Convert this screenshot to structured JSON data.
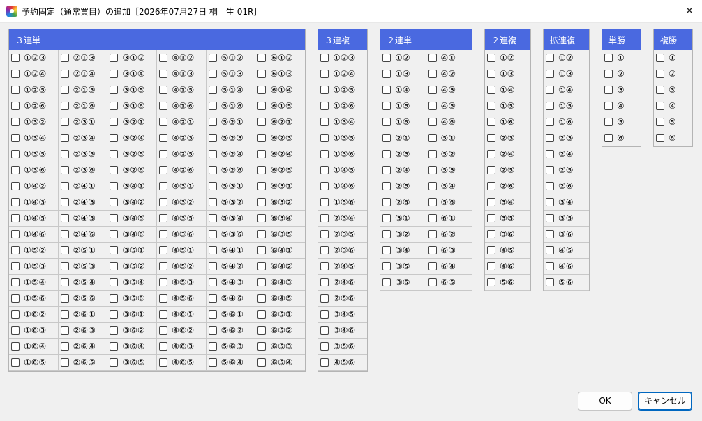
{
  "window": {
    "title": "予約固定（通常買目）の追加［2026年07月27日 桐　生 01R］",
    "close_icon": "✕"
  },
  "groups": [
    {
      "id": "sanrentan",
      "label": "３連単",
      "cols": 6,
      "items": [
        "①②③",
        "②①③",
        "③①②",
        "④①②",
        "⑤①②",
        "⑥①②",
        "①②④",
        "②①④",
        "③①④",
        "④①③",
        "⑤①③",
        "⑥①③",
        "①②⑤",
        "②①⑤",
        "③①⑤",
        "④①⑤",
        "⑤①④",
        "⑥①④",
        "①②⑥",
        "②①⑥",
        "③①⑥",
        "④①⑥",
        "⑤①⑥",
        "⑥①⑤",
        "①③②",
        "②③①",
        "③②①",
        "④②①",
        "⑤②①",
        "⑥②①",
        "①③④",
        "②③④",
        "③②④",
        "④②③",
        "⑤②③",
        "⑥②③",
        "①③⑤",
        "②③⑤",
        "③②⑤",
        "④②⑤",
        "⑤②④",
        "⑥②④",
        "①③⑥",
        "②③⑥",
        "③②⑥",
        "④②⑥",
        "⑤②⑥",
        "⑥②⑤",
        "①④②",
        "②④①",
        "③④①",
        "④③①",
        "⑤③①",
        "⑥③①",
        "①④③",
        "②④③",
        "③④②",
        "④③②",
        "⑤③②",
        "⑥③②",
        "①④⑤",
        "②④⑤",
        "③④⑤",
        "④③⑤",
        "⑤③④",
        "⑥③④",
        "①④⑥",
        "②④⑥",
        "③④⑥",
        "④③⑥",
        "⑤③⑥",
        "⑥③⑤",
        "①⑤②",
        "②⑤①",
        "③⑤①",
        "④⑤①",
        "⑤④①",
        "⑥④①",
        "①⑤③",
        "②⑤③",
        "③⑤②",
        "④⑤②",
        "⑤④②",
        "⑥④②",
        "①⑤④",
        "②⑤④",
        "③⑤④",
        "④⑤③",
        "⑤④③",
        "⑥④③",
        "①⑤⑥",
        "②⑤⑥",
        "③⑤⑥",
        "④⑤⑥",
        "⑤④⑥",
        "⑥④⑤",
        "①⑥②",
        "②⑥①",
        "③⑥①",
        "④⑥①",
        "⑤⑥①",
        "⑥⑤①",
        "①⑥③",
        "②⑥③",
        "③⑥②",
        "④⑥②",
        "⑤⑥②",
        "⑥⑤②",
        "①⑥④",
        "②⑥④",
        "③⑥④",
        "④⑥③",
        "⑤⑥③",
        "⑥⑤③",
        "①⑥⑤",
        "②⑥⑤",
        "③⑥⑤",
        "④⑥⑤",
        "⑤⑥④",
        "⑥⑤④"
      ]
    },
    {
      "id": "sanrenpuku",
      "label": "３連複",
      "cols": 1,
      "items": [
        "①②③",
        "①②④",
        "①②⑤",
        "①②⑥",
        "①③④",
        "①③⑤",
        "①③⑥",
        "①④⑤",
        "①④⑥",
        "①⑤⑥",
        "②③④",
        "②③⑤",
        "②③⑥",
        "②④⑤",
        "②④⑥",
        "②⑤⑥",
        "③④⑤",
        "③④⑥",
        "③⑤⑥",
        "④⑤⑥"
      ]
    },
    {
      "id": "nirentan",
      "label": "２連単",
      "cols": 2,
      "items": [
        "①②",
        "④①",
        "①③",
        "④②",
        "①④",
        "④③",
        "①⑤",
        "④⑤",
        "①⑥",
        "④⑥",
        "②①",
        "⑤①",
        "②③",
        "⑤②",
        "②④",
        "⑤③",
        "②⑤",
        "⑤④",
        "②⑥",
        "⑤⑥",
        "③①",
        "⑥①",
        "③②",
        "⑥②",
        "③④",
        "⑥③",
        "③⑤",
        "⑥④",
        "③⑥",
        "⑥⑤"
      ]
    },
    {
      "id": "nirenpuku",
      "label": "２連複",
      "cols": 1,
      "items": [
        "①②",
        "①③",
        "①④",
        "①⑤",
        "①⑥",
        "②③",
        "②④",
        "②⑤",
        "②⑥",
        "③④",
        "③⑤",
        "③⑥",
        "④⑤",
        "④⑥",
        "⑤⑥"
      ]
    },
    {
      "id": "kakurenpuku",
      "label": "拡連複",
      "cols": 1,
      "items": [
        "①②",
        "①③",
        "①④",
        "①⑤",
        "①⑥",
        "②③",
        "②④",
        "②⑤",
        "②⑥",
        "③④",
        "③⑤",
        "③⑥",
        "④⑤",
        "④⑥",
        "⑤⑥"
      ]
    },
    {
      "id": "tansho",
      "label": "単勝",
      "cols": 1,
      "items": [
        "①",
        "②",
        "③",
        "④",
        "⑤",
        "⑥"
      ]
    },
    {
      "id": "fukusho",
      "label": "複勝",
      "cols": 1,
      "items": [
        "①",
        "②",
        "③",
        "④",
        "⑤",
        "⑥"
      ]
    }
  ],
  "buttons": {
    "ok": "OK",
    "cancel": "キャンセル"
  }
}
